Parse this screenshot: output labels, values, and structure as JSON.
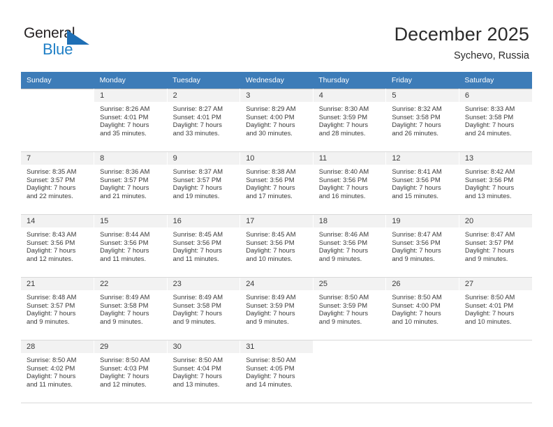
{
  "brand": {
    "name_top": "General",
    "name_bottom": "Blue",
    "triangle_icon": "blue-triangle-icon",
    "color_dark": "#231f20",
    "color_blue": "#1f7fc6"
  },
  "header": {
    "month_title": "December 2025",
    "location": "Sychevo, Russia"
  },
  "theme": {
    "header_row_bg": "#3d7cb8",
    "daynum_bg": "#f2f2f2",
    "text": "#3a3a3a"
  },
  "calendar": {
    "weekday_headers": [
      "Sunday",
      "Monday",
      "Tuesday",
      "Wednesday",
      "Thursday",
      "Friday",
      "Saturday"
    ],
    "weeks": [
      [
        {
          "day": "",
          "lines": []
        },
        {
          "day": "1",
          "lines": [
            "Sunrise: 8:26 AM",
            "Sunset: 4:01 PM",
            "Daylight: 7 hours",
            "and 35 minutes."
          ]
        },
        {
          "day": "2",
          "lines": [
            "Sunrise: 8:27 AM",
            "Sunset: 4:01 PM",
            "Daylight: 7 hours",
            "and 33 minutes."
          ]
        },
        {
          "day": "3",
          "lines": [
            "Sunrise: 8:29 AM",
            "Sunset: 4:00 PM",
            "Daylight: 7 hours",
            "and 30 minutes."
          ]
        },
        {
          "day": "4",
          "lines": [
            "Sunrise: 8:30 AM",
            "Sunset: 3:59 PM",
            "Daylight: 7 hours",
            "and 28 minutes."
          ]
        },
        {
          "day": "5",
          "lines": [
            "Sunrise: 8:32 AM",
            "Sunset: 3:58 PM",
            "Daylight: 7 hours",
            "and 26 minutes."
          ]
        },
        {
          "day": "6",
          "lines": [
            "Sunrise: 8:33 AM",
            "Sunset: 3:58 PM",
            "Daylight: 7 hours",
            "and 24 minutes."
          ]
        }
      ],
      [
        {
          "day": "7",
          "lines": [
            "Sunrise: 8:35 AM",
            "Sunset: 3:57 PM",
            "Daylight: 7 hours",
            "and 22 minutes."
          ]
        },
        {
          "day": "8",
          "lines": [
            "Sunrise: 8:36 AM",
            "Sunset: 3:57 PM",
            "Daylight: 7 hours",
            "and 21 minutes."
          ]
        },
        {
          "day": "9",
          "lines": [
            "Sunrise: 8:37 AM",
            "Sunset: 3:57 PM",
            "Daylight: 7 hours",
            "and 19 minutes."
          ]
        },
        {
          "day": "10",
          "lines": [
            "Sunrise: 8:38 AM",
            "Sunset: 3:56 PM",
            "Daylight: 7 hours",
            "and 17 minutes."
          ]
        },
        {
          "day": "11",
          "lines": [
            "Sunrise: 8:40 AM",
            "Sunset: 3:56 PM",
            "Daylight: 7 hours",
            "and 16 minutes."
          ]
        },
        {
          "day": "12",
          "lines": [
            "Sunrise: 8:41 AM",
            "Sunset: 3:56 PM",
            "Daylight: 7 hours",
            "and 15 minutes."
          ]
        },
        {
          "day": "13",
          "lines": [
            "Sunrise: 8:42 AM",
            "Sunset: 3:56 PM",
            "Daylight: 7 hours",
            "and 13 minutes."
          ]
        }
      ],
      [
        {
          "day": "14",
          "lines": [
            "Sunrise: 8:43 AM",
            "Sunset: 3:56 PM",
            "Daylight: 7 hours",
            "and 12 minutes."
          ]
        },
        {
          "day": "15",
          "lines": [
            "Sunrise: 8:44 AM",
            "Sunset: 3:56 PM",
            "Daylight: 7 hours",
            "and 11 minutes."
          ]
        },
        {
          "day": "16",
          "lines": [
            "Sunrise: 8:45 AM",
            "Sunset: 3:56 PM",
            "Daylight: 7 hours",
            "and 11 minutes."
          ]
        },
        {
          "day": "17",
          "lines": [
            "Sunrise: 8:45 AM",
            "Sunset: 3:56 PM",
            "Daylight: 7 hours",
            "and 10 minutes."
          ]
        },
        {
          "day": "18",
          "lines": [
            "Sunrise: 8:46 AM",
            "Sunset: 3:56 PM",
            "Daylight: 7 hours",
            "and 9 minutes."
          ]
        },
        {
          "day": "19",
          "lines": [
            "Sunrise: 8:47 AM",
            "Sunset: 3:56 PM",
            "Daylight: 7 hours",
            "and 9 minutes."
          ]
        },
        {
          "day": "20",
          "lines": [
            "Sunrise: 8:47 AM",
            "Sunset: 3:57 PM",
            "Daylight: 7 hours",
            "and 9 minutes."
          ]
        }
      ],
      [
        {
          "day": "21",
          "lines": [
            "Sunrise: 8:48 AM",
            "Sunset: 3:57 PM",
            "Daylight: 7 hours",
            "and 9 minutes."
          ]
        },
        {
          "day": "22",
          "lines": [
            "Sunrise: 8:49 AM",
            "Sunset: 3:58 PM",
            "Daylight: 7 hours",
            "and 9 minutes."
          ]
        },
        {
          "day": "23",
          "lines": [
            "Sunrise: 8:49 AM",
            "Sunset: 3:58 PM",
            "Daylight: 7 hours",
            "and 9 minutes."
          ]
        },
        {
          "day": "24",
          "lines": [
            "Sunrise: 8:49 AM",
            "Sunset: 3:59 PM",
            "Daylight: 7 hours",
            "and 9 minutes."
          ]
        },
        {
          "day": "25",
          "lines": [
            "Sunrise: 8:50 AM",
            "Sunset: 3:59 PM",
            "Daylight: 7 hours",
            "and 9 minutes."
          ]
        },
        {
          "day": "26",
          "lines": [
            "Sunrise: 8:50 AM",
            "Sunset: 4:00 PM",
            "Daylight: 7 hours",
            "and 10 minutes."
          ]
        },
        {
          "day": "27",
          "lines": [
            "Sunrise: 8:50 AM",
            "Sunset: 4:01 PM",
            "Daylight: 7 hours",
            "and 10 minutes."
          ]
        }
      ],
      [
        {
          "day": "28",
          "lines": [
            "Sunrise: 8:50 AM",
            "Sunset: 4:02 PM",
            "Daylight: 7 hours",
            "and 11 minutes."
          ]
        },
        {
          "day": "29",
          "lines": [
            "Sunrise: 8:50 AM",
            "Sunset: 4:03 PM",
            "Daylight: 7 hours",
            "and 12 minutes."
          ]
        },
        {
          "day": "30",
          "lines": [
            "Sunrise: 8:50 AM",
            "Sunset: 4:04 PM",
            "Daylight: 7 hours",
            "and 13 minutes."
          ]
        },
        {
          "day": "31",
          "lines": [
            "Sunrise: 8:50 AM",
            "Sunset: 4:05 PM",
            "Daylight: 7 hours",
            "and 14 minutes."
          ]
        },
        {
          "day": "",
          "lines": []
        },
        {
          "day": "",
          "lines": []
        },
        {
          "day": "",
          "lines": []
        }
      ]
    ]
  }
}
